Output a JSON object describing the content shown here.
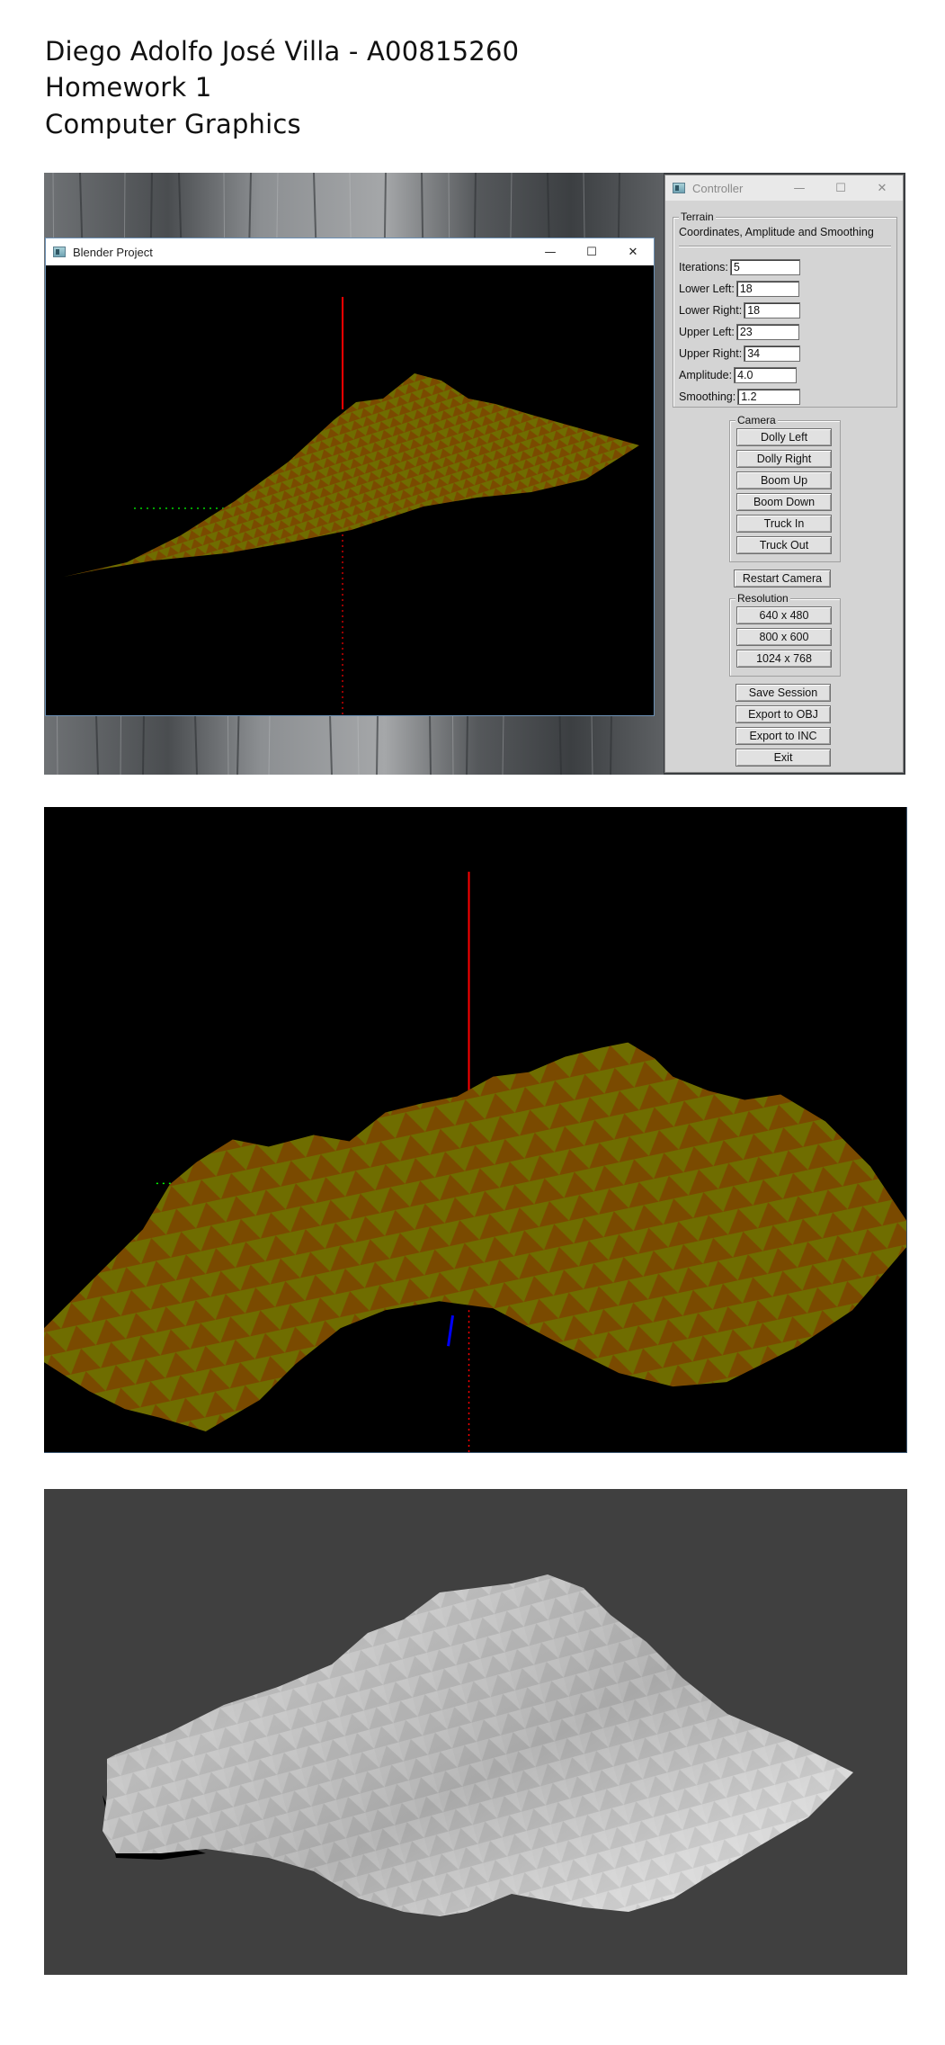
{
  "header": {
    "line1": "Diego Adolfo José Villa - A00815260",
    "line2": "Homework 1",
    "line3": "Computer Graphics"
  },
  "blender_window": {
    "title": "Blender Project",
    "minimize_glyph": "—",
    "maximize_glyph": "☐",
    "close_glyph": "✕"
  },
  "controller": {
    "title": "Controller",
    "minimize_glyph": "—",
    "maximize_glyph": "☐",
    "close_glyph": "✕",
    "terrain": {
      "label": "Terrain",
      "subtitle": "Coordinates, Amplitude and Smoothing",
      "fields": {
        "iterations": {
          "label": "Iterations:",
          "value": "5"
        },
        "lower_left": {
          "label": "Lower Left:",
          "value": "18"
        },
        "lower_right": {
          "label": "Lower Right:",
          "value": "18"
        },
        "upper_left": {
          "label": "Upper Left:",
          "value": "23"
        },
        "upper_right": {
          "label": "Upper Right:",
          "value": "34"
        },
        "amplitude": {
          "label": "Amplitude:",
          "value": "4.0"
        },
        "smoothing": {
          "label": "Smoothing:",
          "value": "1.2"
        }
      }
    },
    "camera": {
      "label": "Camera",
      "dolly_left": "Dolly Left",
      "dolly_right": "Dolly Right",
      "boom_up": "Boom Up",
      "boom_down": "Boom Down",
      "truck_in": "Truck In",
      "truck_out": "Truck Out"
    },
    "restart_camera": "Restart Camera",
    "resolution": {
      "label": "Resolution",
      "r640": "640 x 480",
      "r800": "800 x 600",
      "r1024": "1024 x 768"
    },
    "save_session": "Save Session",
    "export_obj": "Export to OBJ",
    "export_inc": "Export to INC",
    "exit": "Exit"
  },
  "colors": {
    "terrain_light": "#6f6d00",
    "terrain_dark": "#7a4a00",
    "y_axis": "#ff0000",
    "z_axis": "#0000ff",
    "render_bg": "#404040",
    "controller_bg": "#d4d4d4"
  },
  "icons": {
    "app_icon": "window-app-icon",
    "minimize": "minimize-icon",
    "maximize": "maximize-icon",
    "close": "close-icon"
  }
}
